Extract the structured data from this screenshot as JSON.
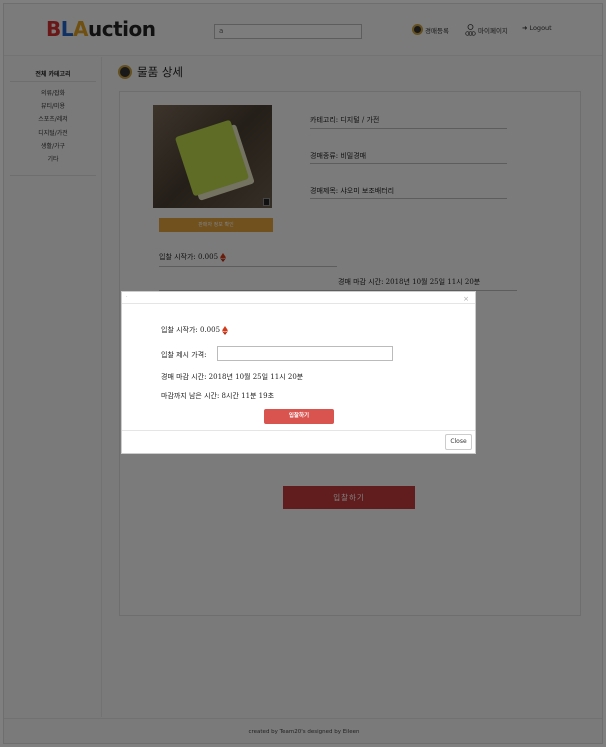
{
  "header": {
    "logo": [
      "B",
      "L",
      "A",
      "uction"
    ],
    "logo_colors": [
      "#d32f2f",
      "#1e63c6",
      "#e0a020",
      "#222222"
    ],
    "search_value": "a",
    "nav": {
      "register": "경매등록",
      "mypage": "마이페이지",
      "logout": "Logout"
    }
  },
  "sidebar": {
    "title": "전체 카테고리",
    "items": [
      "의류/잡화",
      "뷰티/미용",
      "스포츠/레저",
      "디지털/가전",
      "생활/가구",
      "기타"
    ]
  },
  "page": {
    "title": "물품 상세"
  },
  "product": {
    "category": "카테고리: 디지털 / 가전",
    "auction_type": "경매종류: 비밀경매",
    "auction_title": "경매제목: 샤오미 보조배터리",
    "seller_button": "판매자 정보 확인",
    "start_price": "입찰 시작가: 0.005",
    "end_time": "경매 마감 시간: 2018년 10월 25일 11시 20분",
    "bid_button": "입찰하기"
  },
  "modal": {
    "start_price": "입찰 시작가: 0.005",
    "bid_price_label": "입찰 제시 가격:",
    "bid_price_value": "",
    "end_time": "경매 마감 시간: 2018년 10월 25일 11시 20분",
    "remaining": "마감까지 남은 시간: 8시간 11분 19초",
    "bid_button": "입찰하기",
    "close_button": "Close",
    "x": "×"
  },
  "footer": {
    "text": "created by Team20's designed by Eileen"
  },
  "colors": {
    "accent_red": "#d9534f",
    "seller_orange": "#e3a23b",
    "eth_red": "#d33a1a"
  }
}
